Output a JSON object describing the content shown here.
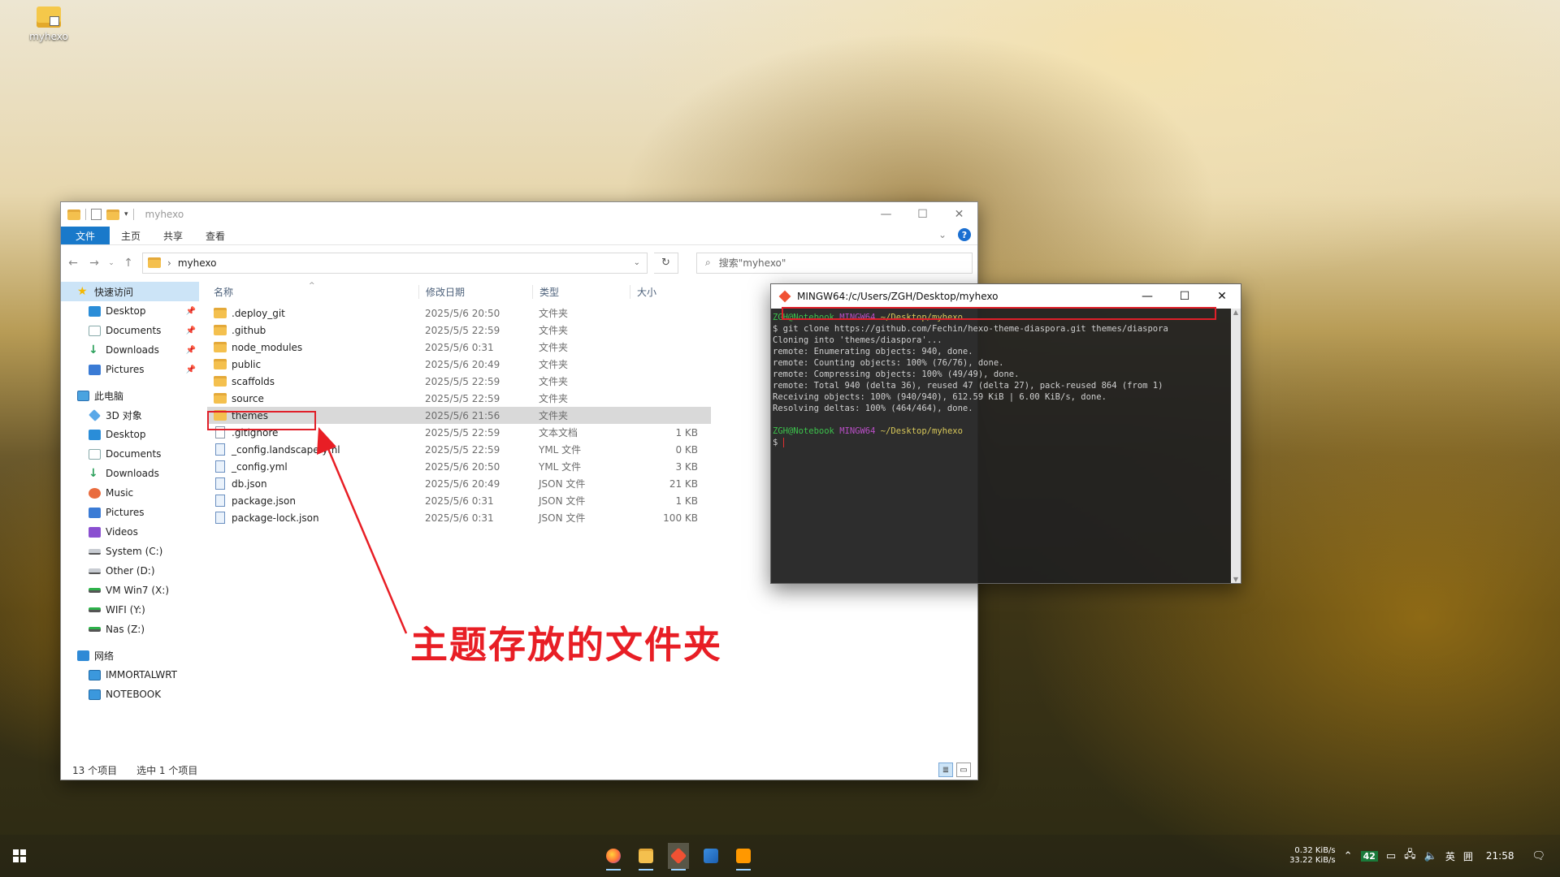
{
  "desktop": {
    "icon_label": "myhexo"
  },
  "explorer": {
    "title": "myhexo",
    "ribbon_tabs": [
      "文件",
      "主页",
      "共享",
      "查看"
    ],
    "address": {
      "path": "myhexo"
    },
    "search_placeholder": "搜索\"myhexo\"",
    "nav": {
      "quick_access": "快速访问",
      "quick_items": [
        "Desktop",
        "Documents",
        "Downloads",
        "Pictures"
      ],
      "this_pc": "此电脑",
      "pc_items": [
        "3D 对象",
        "Desktop",
        "Documents",
        "Downloads",
        "Music",
        "Pictures",
        "Videos",
        "System (C:)",
        "Other (D:)",
        "VM Win7 (X:)",
        "WIFI (Y:)",
        "Nas (Z:)"
      ],
      "network": "网络",
      "network_items": [
        "IMMORTALWRT",
        "NOTEBOOK"
      ]
    },
    "columns": {
      "name": "名称",
      "date": "修改日期",
      "type": "类型",
      "size": "大小"
    },
    "files": [
      {
        "name": ".deploy_git",
        "date": "2025/5/6 20:50",
        "type": "文件夹",
        "size": ""
      },
      {
        "name": ".github",
        "date": "2025/5/5 22:59",
        "type": "文件夹",
        "size": ""
      },
      {
        "name": "node_modules",
        "date": "2025/5/6 0:31",
        "type": "文件夹",
        "size": ""
      },
      {
        "name": "public",
        "date": "2025/5/6 20:49",
        "type": "文件夹",
        "size": ""
      },
      {
        "name": "scaffolds",
        "date": "2025/5/5 22:59",
        "type": "文件夹",
        "size": ""
      },
      {
        "name": "source",
        "date": "2025/5/5 22:59",
        "type": "文件夹",
        "size": ""
      },
      {
        "name": "themes",
        "date": "2025/5/6 21:56",
        "type": "文件夹",
        "size": ""
      },
      {
        "name": ".gitignore",
        "date": "2025/5/5 22:59",
        "type": "文本文档",
        "size": "1 KB"
      },
      {
        "name": "_config.landscape.yml",
        "date": "2025/5/5 22:59",
        "type": "YML 文件",
        "size": "0 KB"
      },
      {
        "name": "_config.yml",
        "date": "2025/5/6 20:50",
        "type": "YML 文件",
        "size": "3 KB"
      },
      {
        "name": "db.json",
        "date": "2025/5/6 20:49",
        "type": "JSON 文件",
        "size": "21 KB"
      },
      {
        "name": "package.json",
        "date": "2025/5/6 0:31",
        "type": "JSON 文件",
        "size": "1 KB"
      },
      {
        "name": "package-lock.json",
        "date": "2025/5/6 0:31",
        "type": "JSON 文件",
        "size": "100 KB"
      }
    ],
    "status": {
      "count": "13 个项目",
      "selected": "选中 1 个项目"
    }
  },
  "terminal": {
    "title": "MINGW64:/c/Users/ZGH/Desktop/myhexo",
    "prompt_user": "ZGH@Notebook",
    "prompt_host": "MINGW64",
    "prompt_path": "~/Desktop/myhexo",
    "command": "git clone https://github.com/Fechin/hexo-theme-diaspora.git themes/diaspora",
    "output": [
      "Cloning into 'themes/diaspora'...",
      "remote: Enumerating objects: 940, done.",
      "remote: Counting objects: 100% (76/76), done.",
      "remote: Compressing objects: 100% (49/49), done.",
      "remote: Total 940 (delta 36), reused 47 (delta 27), pack-reused 864 (from 1)",
      "Receiving objects: 100% (940/940), 612.59 KiB | 6.00 KiB/s, done.",
      "Resolving deltas: 100% (464/464), done."
    ]
  },
  "annotation": {
    "text": "主题存放的文件夹",
    "color": "#e81e25"
  },
  "taskbar": {
    "net_up": "0.32 KiB/s",
    "net_down": "33.22 KiB/s",
    "badge": "42",
    "ime": "英",
    "ime_mode": "囲",
    "clock": "21:58"
  }
}
